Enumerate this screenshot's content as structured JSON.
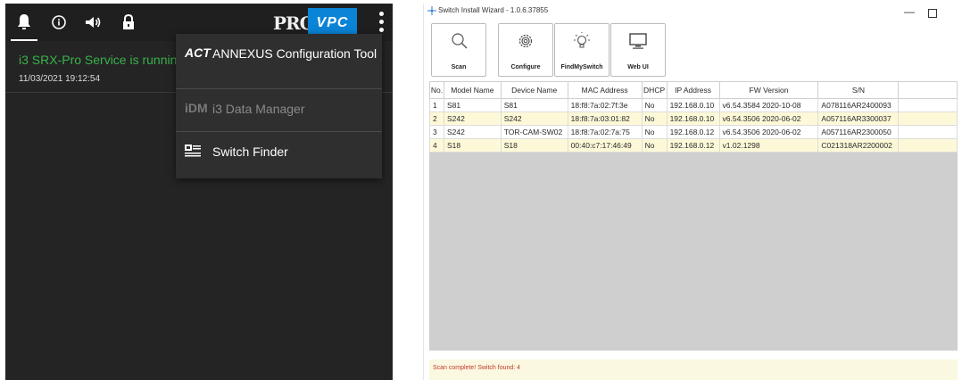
{
  "left_panel": {
    "topbar": {
      "icons": [
        "bell-icon",
        "info-icon",
        "speaker-icon",
        "lock-icon"
      ],
      "pro_logo": "PRO",
      "vpc_label": "VPC"
    },
    "status": {
      "text": "i3 SRX-Pro Service is running",
      "timestamp": "11/03/2021 19:12:54"
    },
    "menu": {
      "items": [
        {
          "icon_text": "ACT",
          "label": "ANNEXUS Configuration Tool",
          "enabled": true
        },
        {
          "icon_text": "iDM",
          "label": "i3 Data Manager",
          "enabled": false
        },
        {
          "icon_text": "",
          "label": "Switch Finder",
          "enabled": true
        }
      ]
    }
  },
  "window": {
    "title": "Switch Install Wizard - 1.0.6.37855",
    "toolbar": [
      {
        "label": "Scan",
        "icon": "search-icon"
      },
      {
        "label": "Configure",
        "icon": "gear-icon"
      },
      {
        "label": "FindMySwitch",
        "icon": "lightbulb-icon"
      },
      {
        "label": "Web UI",
        "icon": "monitor-icon"
      }
    ],
    "table": {
      "headers": [
        "No.",
        "Model Name",
        "Device Name",
        "MAC Address",
        "DHCP",
        "IP Address",
        "FW Version",
        "S/N"
      ],
      "rows": [
        [
          "1",
          "S81",
          "S81",
          "18:f8:7a:02:7f:3e",
          "No",
          "192.168.0.10",
          "v6.54.3584 2020-10-08",
          "A078116AR2400093"
        ],
        [
          "2",
          "S242",
          "S242",
          "18:f8:7a:03:01:82",
          "No",
          "192.168.0.10",
          "v6.54.3506 2020-06-02",
          "A057116AR3300037"
        ],
        [
          "3",
          "S242",
          "TOR-CAM-SW02",
          "18:f8:7a:02:7a:75",
          "No",
          "192.168.0.12",
          "v6.54.3506 2020-06-02",
          "A057116AR2300050"
        ],
        [
          "4",
          "S18",
          "S18",
          "00:40:c7:17:46:49",
          "No",
          "192.168.0.12",
          "v1.02.1298",
          "C021318AR2200002"
        ]
      ]
    },
    "status_message": "Scan complete! Switch found: 4"
  },
  "colors": {
    "dark_bg": "#242424",
    "accent_blue": "#0a84d6",
    "status_green": "#39b24a",
    "row_highlight": "#fdf9d8",
    "error_red": "#c0392b"
  }
}
